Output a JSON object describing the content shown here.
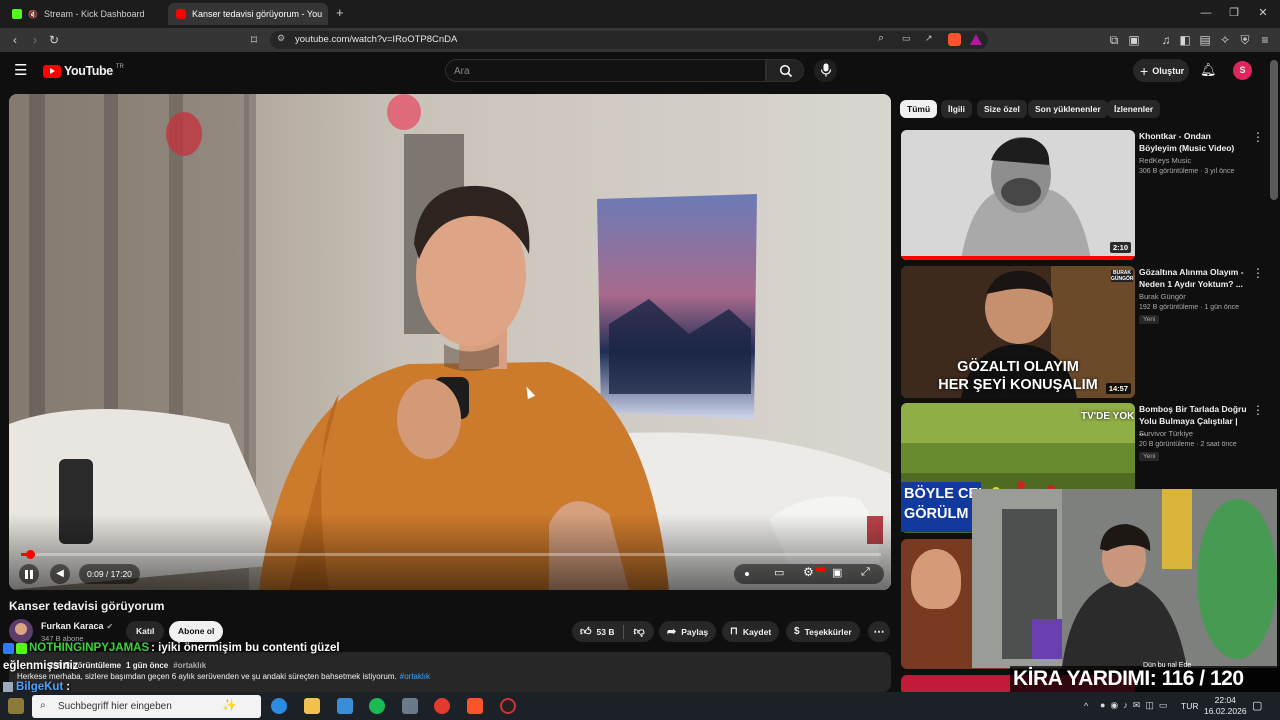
{
  "browser": {
    "tabs": [
      {
        "title": "Stream - Kick Dashboard",
        "active": false
      },
      {
        "title": "Kanser tedavisi görüyorum - You",
        "active": true
      }
    ],
    "new_tab": "+",
    "url": "youtube.com/watch?v=IRoOTP8CnDA"
  },
  "youtube": {
    "logo_text": "YouTube",
    "logo_region": "TR",
    "search_placeholder": "Ara",
    "create_label": "Oluştur",
    "avatar_letter": "S",
    "chips": [
      "Tümü",
      "İlgili",
      "Size özel",
      "Son yüklenenler",
      "İzlenenler"
    ],
    "recommendations": [
      {
        "title": "Khontkar - Ondan Böyleyim (Music Video)",
        "channel": "RedKeys Music",
        "meta": "306 B görüntüleme · 3 yıl önce",
        "duration": "2:10",
        "is_new": false
      },
      {
        "title": "Gözaltına Alınma Olayım - Neden 1 Aydır Yoktum? ...",
        "channel": "Burak Güngör",
        "meta": "192 B görüntüleme · 1 gün önce",
        "duration": "14:57",
        "is_new": true,
        "thumb_caption": [
          "GÖZALTI OLAYIM",
          "HER ŞEYİ KONUŞALIM"
        ]
      },
      {
        "title": "Bomboş Bir Tarlada Doğru Yolu Bulmaya Çalıştılar | ...",
        "channel": "Survivor Türkiye",
        "meta": "20 B görüntüleme · 2 saat önce",
        "is_new": true,
        "thumb_caption": [
          "TV'DE YOK",
          "BÖYLE CEZA",
          "GÖRÜLM"
        ]
      }
    ],
    "new_badge": "Yeni",
    "player": {
      "time": "0:09 / 17:20",
      "progress": 0.0087
    },
    "video_title": "Kanser tedavisi görüyorum",
    "channel_name": "Furkan Karaca",
    "subscribers": "347 B abone",
    "join_label": "Katıl",
    "subscribe_label": "Abone ol",
    "like_count": "53 B",
    "share_label": "Paylaş",
    "save_label": "Kaydet",
    "thanks_label": "Teşekkürler",
    "desc_meta": "1 gün önce",
    "desc_views_partial": "298 B görüntüleme",
    "desc_tag": "#ortaklık",
    "desc_text": "Herkese merhaba, sizlere başımdan geçen 6 aylık serüvenden ve şu andaki süreçten bahsetmek istiyorum.",
    "desc_link": "#ortaklık"
  },
  "stream_overlay": {
    "chat": [
      {
        "user": "NOTHINGINPYJAMAS",
        "message": " : iyiki önermişim bu contenti güzel",
        "continuation": "eğlenmişsiniz",
        "color": "#3dd13d"
      },
      {
        "user": "BilgeKut",
        "message": " :",
        "color": "#4aa3ff"
      }
    ],
    "goal_text": "KİRA YARDIMI: 116 / 120",
    "webcam_under_text": "Dün bu nal Ede"
  },
  "taskbar": {
    "search_placeholder": "Suchbegriff hier eingeben",
    "lang": "TUR",
    "time": "22:04",
    "date": "16.02.2026"
  },
  "colors": {
    "yt_red": "#ff0000",
    "progress_red": "#f00",
    "avatar": "#e0245e",
    "kick_green": "#53fc18"
  }
}
